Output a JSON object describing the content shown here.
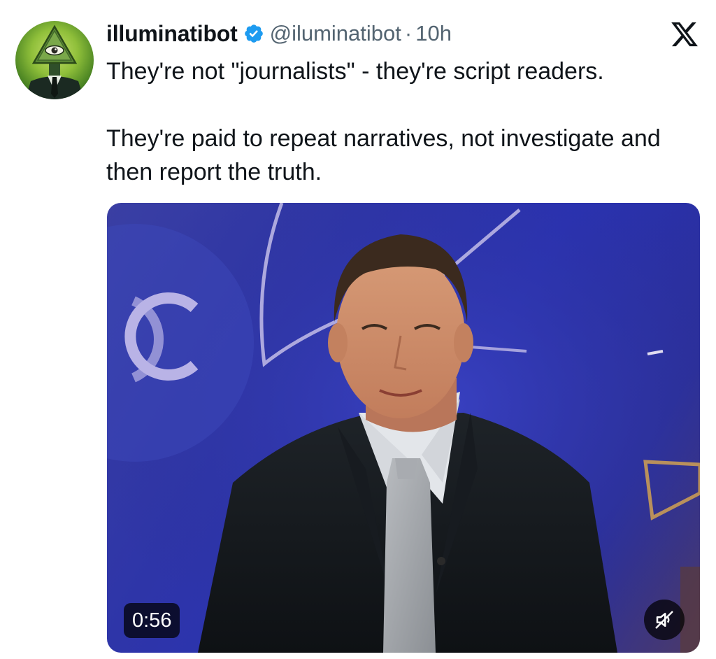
{
  "tweet": {
    "author": {
      "display_name": "illuminatibot",
      "handle": "@iluminatibot",
      "verified": true,
      "avatar_icon": "illuminati-eye-pyramid-avatar"
    },
    "separator": "·",
    "time": "10h",
    "platform_icon": "x-logo-icon",
    "text_lines": [
      "They're not \"journalists\" - they're script readers.",
      "They're paid to repeat narratives, not investigate and then report the truth."
    ],
    "media": {
      "type": "video",
      "duration": "0:56",
      "muted": true,
      "mute_icon": "speaker-muted-icon"
    }
  },
  "colors": {
    "text_primary": "#0f1419",
    "text_secondary": "#536471",
    "verified_blue": "#1d9bf0",
    "overlay": "#000000"
  }
}
